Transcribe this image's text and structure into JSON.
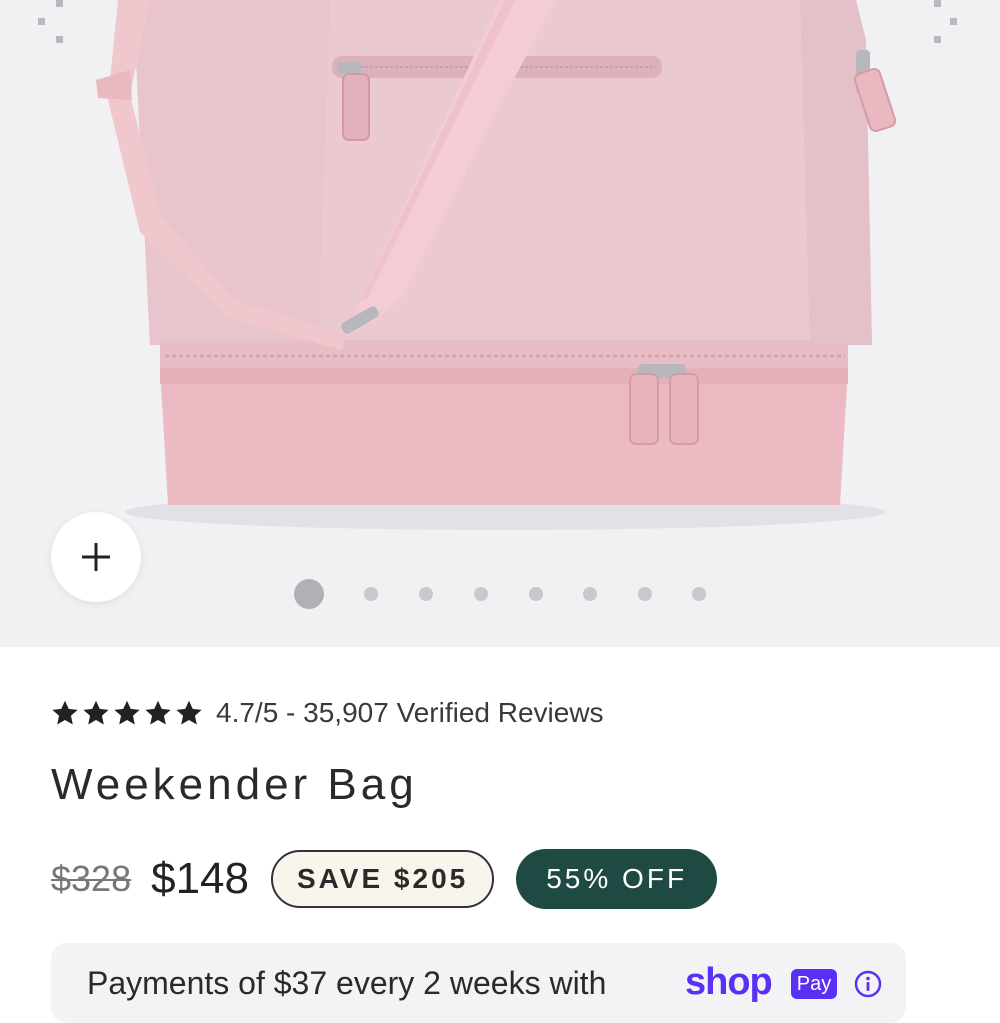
{
  "product": {
    "image_alt": "Pink weekender bag with shoulder strap",
    "gallery_dot_count": 8,
    "active_dot": 1
  },
  "rating": {
    "stars": 5,
    "text": "4.7/5 - 35,907 Verified Reviews"
  },
  "title": "Weekender Bag",
  "price": {
    "original": "$328",
    "current": "$148",
    "save_label": "SAVE $205",
    "discount_label": "55% OFF"
  },
  "payments": {
    "text": "Payments of $37 every 2 weeks with",
    "brand": "shop",
    "brand_pay": "Pay"
  },
  "icons": {
    "zoom": "plus-icon",
    "star": "star-icon",
    "info": "info-icon"
  },
  "colors": {
    "bag_pink": "#e9b5bf",
    "gallery_bg": "#f1f0f3",
    "badge_green": "#1e4a43",
    "badge_cream": "#f8f5ec",
    "shop_purple": "#5a31f4"
  }
}
